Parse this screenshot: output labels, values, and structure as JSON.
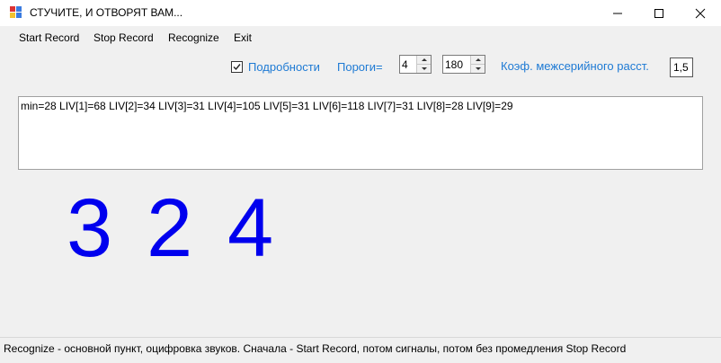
{
  "window": {
    "title": "СТУЧИТЕ, И ОТВОРЯТ ВАМ..."
  },
  "menu": {
    "items": [
      "Start Record",
      "Stop Record",
      "Recognize",
      "Exit"
    ]
  },
  "options": {
    "details_label": "Подробности",
    "details_checked": true,
    "thresholds_label": "Пороги=",
    "threshold1": "4",
    "threshold2": "180",
    "coef_label": "Коэф. межсерийного расст.",
    "coef_value": "1,5"
  },
  "output": {
    "text": "min=28 LIV[1]=68 LIV[2]=34 LIV[3]=31 LIV[4]=105 LIV[5]=31 LIV[6]=118 LIV[7]=31 LIV[8]=28 LIV[9]=29"
  },
  "result": {
    "digits": [
      "3",
      "2",
      "4"
    ]
  },
  "status": {
    "text": "Recognize - основной пункт, оцифровка звуков. Сначала - Start Record, потом сигналы, потом без промедления Stop Record"
  },
  "colors": {
    "accent_label": "#1e7ad4",
    "digits": "#0000ee"
  }
}
